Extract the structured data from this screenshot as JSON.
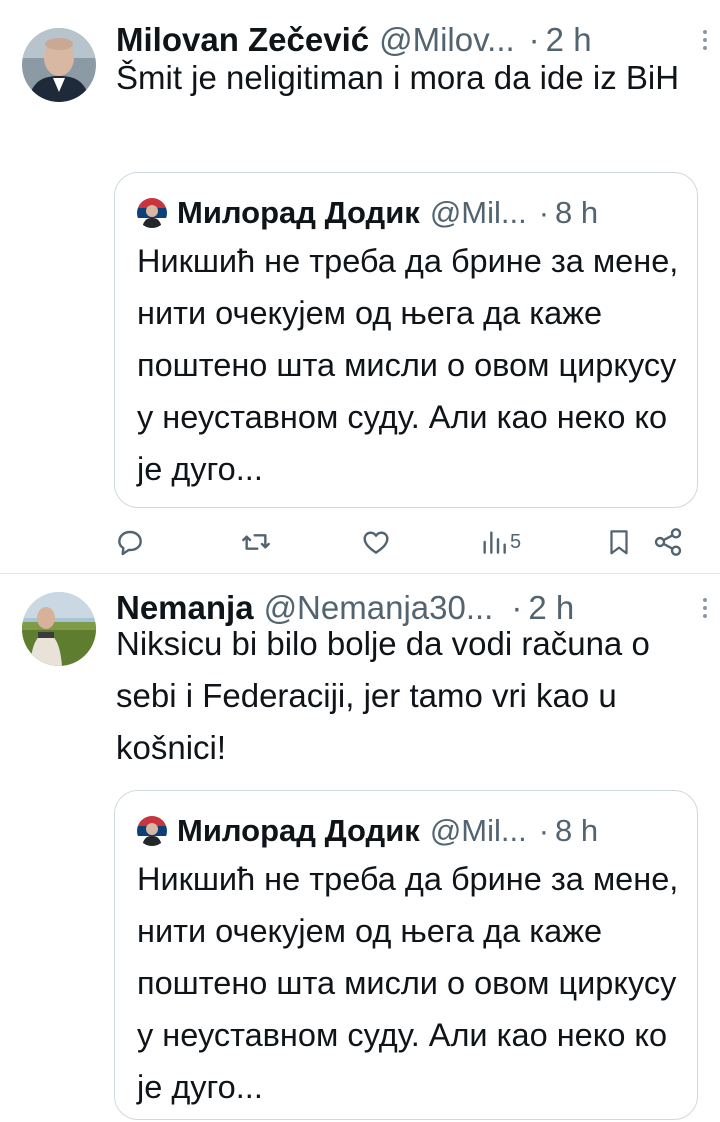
{
  "tweets": [
    {
      "author_name": "Milovan Zečević",
      "author_handle": "@Milov...",
      "separator": "·",
      "time": "2 h",
      "text": "Šmit je neligitiman i mora da ide iz BiH",
      "avatar_icon": "person-portrait-icon",
      "quote": {
        "author_name": "Милорад Додик",
        "author_handle": "@Mil...",
        "separator": "·",
        "time": "8 h",
        "text": "Никшић не треба да брине за мене, нити очекујем од њега да каже поштено шта мисли о овом циркусу у неуставном суду. Али као неко ко је дуго..."
      },
      "actions": {
        "reply_icon": "reply-icon",
        "retweet_icon": "retweet-icon",
        "like_icon": "heart-icon",
        "views_icon": "views-chart-icon",
        "views_count": "5",
        "bookmark_icon": "bookmark-icon",
        "share_icon": "share-icon"
      }
    },
    {
      "author_name": "Nemanja",
      "author_handle": "@Nemanja30...",
      "separator": "·",
      "time": "2 h",
      "text": "Niksicu bi bilo bolje da vodi računa o sebi i Federaciji, jer tamo vri kao u košnici!",
      "avatar_icon": "person-field-photo-icon",
      "quote": {
        "author_name": "Милорад Додик",
        "author_handle": "@Mil...",
        "separator": "·",
        "time": "8 h",
        "text": "Никшић не треба да брине за мене, нити очекујем од њега да каже поштено шта мисли о овом циркусу у неуставном суду. Али као неко ко је дуго..."
      }
    }
  ],
  "colors": {
    "text_primary": "#0f1419",
    "text_secondary": "#536471",
    "border": "#cfd9de",
    "divider": "#e1e6ea"
  }
}
